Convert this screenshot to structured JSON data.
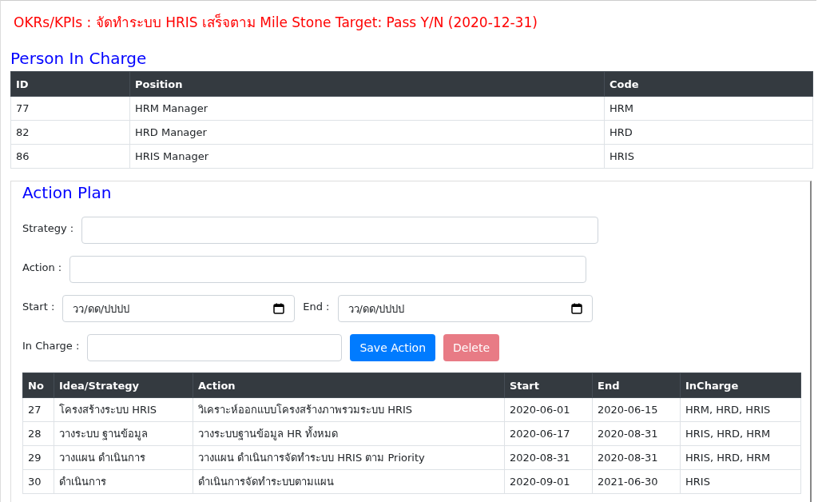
{
  "title": "OKRs/KPIs : จัดทำระบบ HRIS เสร็จตาม Mile Stone Target: Pass Y/N (2020-12-31)",
  "person_in_charge": {
    "heading": "Person In Charge",
    "columns": [
      "ID",
      "Position",
      "Code"
    ],
    "rows": [
      [
        "77",
        "HRM Manager",
        "HRM"
      ],
      [
        "82",
        "HRD Manager",
        "HRD"
      ],
      [
        "86",
        "HRIS Manager",
        "HRIS"
      ]
    ]
  },
  "action_plan": {
    "heading": "Action Plan",
    "strategy": {
      "label": "Strategy :"
    },
    "action": {
      "label": "Action :"
    },
    "start": {
      "label": "Start :",
      "placeholder": "วว/ดด/ปปปป"
    },
    "end": {
      "label": "End :",
      "placeholder": "วว/ดด/ปปปป"
    },
    "in_charge": {
      "label": "In Charge :"
    },
    "buttons": [
      {
        "label": "Save Action",
        "kind": "primary",
        "disabled": false
      },
      {
        "label": "Delete",
        "kind": "danger",
        "disabled": true
      }
    ],
    "table": {
      "columns": [
        "No",
        "Idea/Strategy",
        "Action",
        "Start",
        "End",
        "InCharge"
      ],
      "rows": [
        [
          "27",
          "โครงสร้างระบบ HRIS",
          "วิเคราะห์ออกแบบโครงสร้างภาพรวมระบบ HRIS",
          "2020-06-01",
          "2020-06-15",
          "HRM, HRD, HRIS"
        ],
        [
          "28",
          "วางระบบ ฐานข้อมูล",
          "วางระบบฐานข้อมูล HR ทั้งหมด",
          "2020-06-17",
          "2020-08-31",
          "HRIS, HRD, HRM"
        ],
        [
          "29",
          "วางแผน ดำเนินการ",
          "วางแผน ดำเนินการจัดทำระบบ HRIS ตาม Priority",
          "2020-08-31",
          "2020-08-31",
          "HRIS, HRD, HRM"
        ],
        [
          "30",
          "ดำเนินการ",
          "ดำเนินการจัดทำระบบตามแผน",
          "2020-09-01",
          "2021-06-30",
          "HRIS"
        ]
      ]
    }
  }
}
